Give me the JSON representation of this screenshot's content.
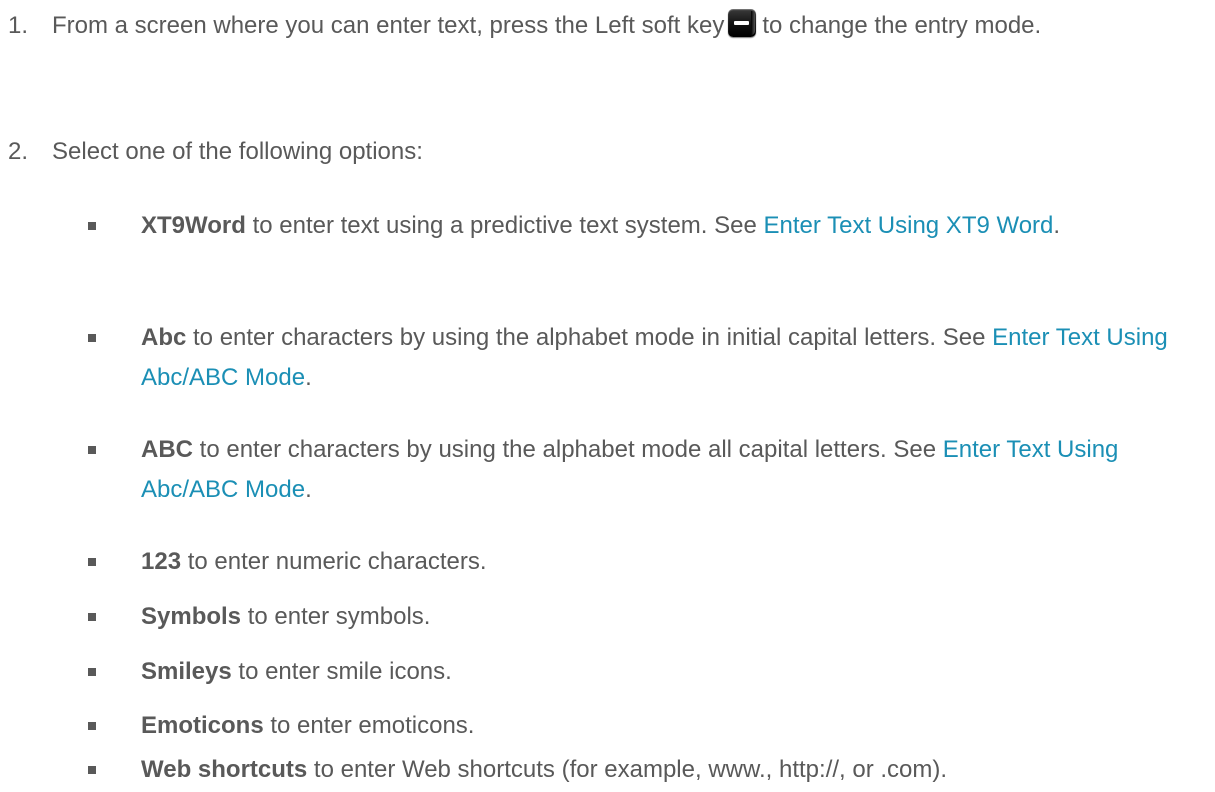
{
  "steps": [
    {
      "number": "1.",
      "text_before": "From a screen where you can enter text, press the Left soft key",
      "icon": "left-soft-key-icon",
      "text_after": "to change the entry mode."
    },
    {
      "number": "2.",
      "text": "Select one of the following options:"
    }
  ],
  "options": [
    {
      "term": "XT9Word",
      "text": " to enter text using a predictive text system. See ",
      "link": "Enter Text Using XT9 Word",
      "tail": "."
    },
    {
      "term": "Abc",
      "text": " to enter characters by using the alphabet mode in initial capital letters. See ",
      "link": "Enter Text Using Abc/ABC Mode",
      "tail": "."
    },
    {
      "term": "ABC",
      "text": " to enter characters by using the alphabet mode all capital letters. See ",
      "link": "Enter Text Using Abc/ABC Mode",
      "tail": "."
    },
    {
      "term": "123",
      "text": " to enter numeric characters."
    },
    {
      "term": "Symbols",
      "text": " to enter symbols."
    },
    {
      "term": "Smileys",
      "text": " to enter smile icons."
    },
    {
      "term": "Emoticons",
      "text": " to enter emoticons."
    },
    {
      "term": "Web shortcuts",
      "text": " to enter Web shortcuts (for example, www., http://, or .com)."
    }
  ],
  "colors": {
    "text": "#595959",
    "link": "#1b8fb5"
  }
}
